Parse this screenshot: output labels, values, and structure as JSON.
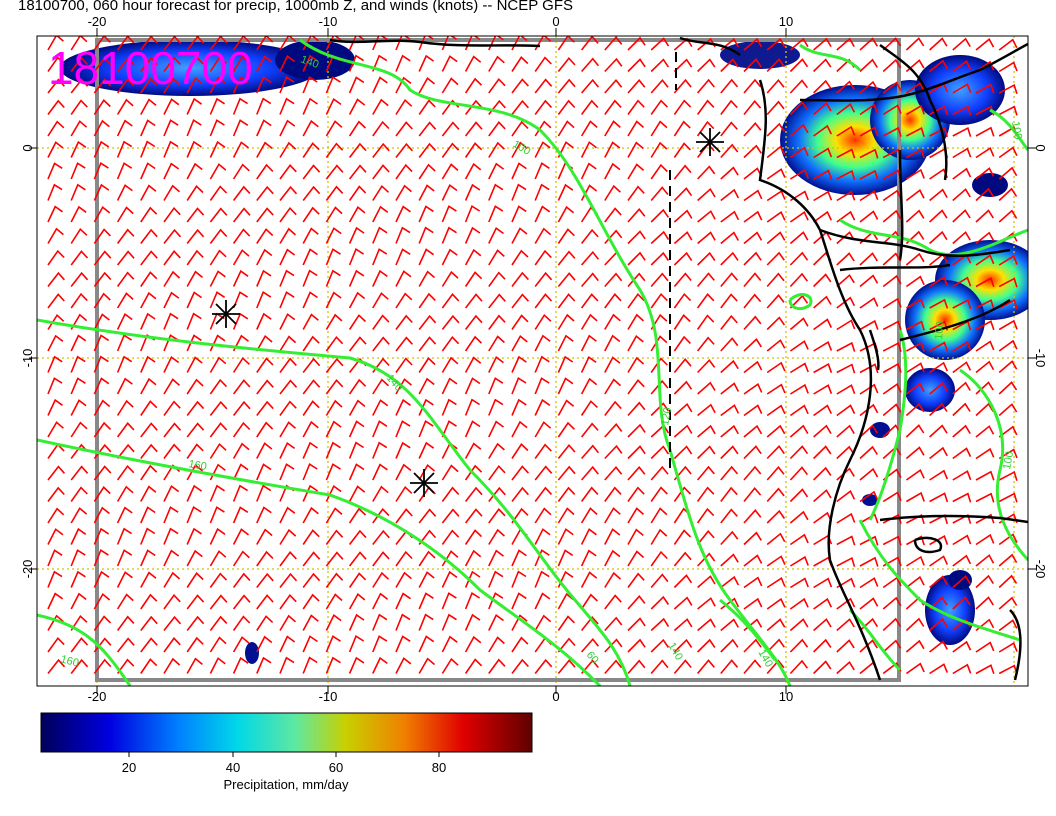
{
  "title": "18100700, 060 hour forecast for precip, 1000mb Z, and winds (knots) -- NCEP GFS",
  "stamp": "18100700",
  "lon_ticks": [
    "-20",
    "-10",
    "0",
    "10"
  ],
  "lat_ticks": [
    "0",
    "-10",
    "-20"
  ],
  "contour_labels": [
    "100",
    "140",
    "160",
    "120",
    "160",
    "60",
    "140",
    "140",
    "100",
    "100",
    "100",
    "140"
  ],
  "colorbar": {
    "label": "Precipitation, mm/day",
    "ticks": [
      "20",
      "40",
      "60",
      "80"
    ],
    "range": [
      2,
      96
    ],
    "colors": [
      "#000080",
      "#0000ff",
      "#00bfff",
      "#00ffff",
      "#7fff7f",
      "#d4d400",
      "#ff8000",
      "#e00000",
      "#800000"
    ]
  },
  "colors": {
    "wind_barb": "#ff0000",
    "contour": "#33ee33",
    "coastline": "#000000",
    "grid": "#d4c000",
    "stamp": "#ff00ff"
  }
}
